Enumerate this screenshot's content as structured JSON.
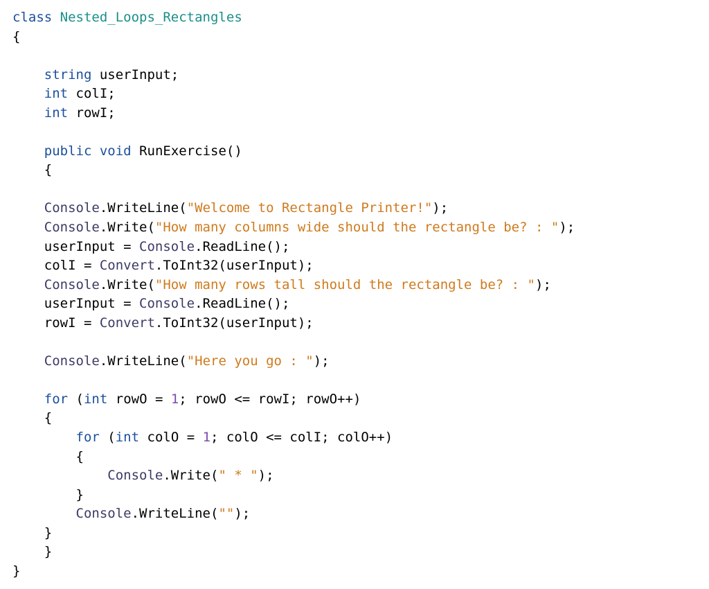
{
  "code": {
    "t0": "class",
    "t1": "Nested_Loops_Rectangles",
    "t2": "{",
    "t3": "string",
    "t4": "userInput;",
    "t5": "int",
    "t6": "colI;",
    "t7": "int",
    "t8": "rowI;",
    "t9": "public",
    "t10": "void",
    "t11": "RunExercise()",
    "t12": "{",
    "t13": "Console",
    "t14": ".WriteLine(",
    "t15": "\"Welcome to Rectangle Printer!\"",
    "t16": ");",
    "t17": "Console",
    "t18": ".Write(",
    "t19": "\"How many columns wide should the rectangle be? : \"",
    "t20": ");",
    "t21": "userInput = ",
    "t22": "Console",
    "t23": ".ReadLine();",
    "t24": "colI = ",
    "t25": "Convert",
    "t26": ".ToInt32(userInput);",
    "t27": "Console",
    "t28": ".Write(",
    "t29": "\"How many rows tall should the rectangle be? : \"",
    "t30": ");",
    "t31": "userInput = ",
    "t32": "Console",
    "t33": ".ReadLine();",
    "t34": "rowI = ",
    "t35": "Convert",
    "t36": ".ToInt32(userInput);",
    "t37": "Console",
    "t38": ".WriteLine(",
    "t39": "\"Here you go : \"",
    "t40": ");",
    "t41": "for",
    "t42": " (",
    "t43": "int",
    "t44": " rowO = ",
    "t45": "1",
    "t46": "; rowO <= rowI; rowO++)",
    "t47": "{",
    "t48": "for",
    "t49": " (",
    "t50": "int",
    "t51": " colO = ",
    "t52": "1",
    "t53": "; colO <= colI; colO++)",
    "t54": "{",
    "t55": "Console",
    "t56": ".Write(",
    "t57": "\" * \"",
    "t58": ");",
    "t59": "}",
    "t60": "Console",
    "t61": ".WriteLine(",
    "t62": "\"\"",
    "t63": ");",
    "t64": "}",
    "t65": "}",
    "t66": "}"
  }
}
